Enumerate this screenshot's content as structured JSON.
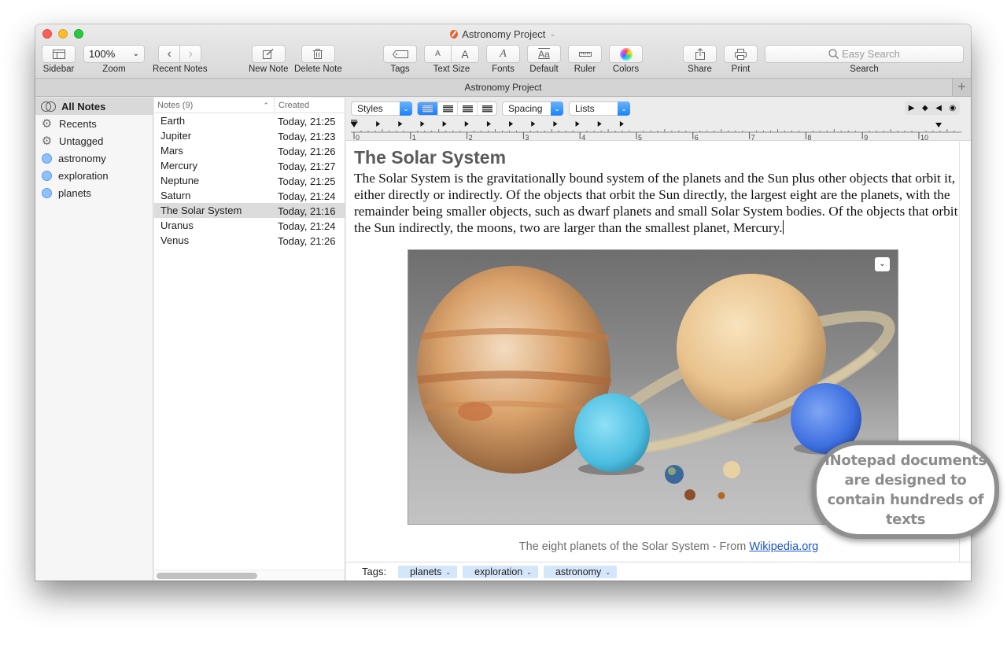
{
  "window": {
    "title": "Astronomy Project",
    "tab_title": "Astronomy Project"
  },
  "toolbar": {
    "sidebar_label": "Sidebar",
    "zoom_value": "100%",
    "zoom_label": "Zoom",
    "recent_notes_label": "Recent Notes",
    "new_note_label": "New Note",
    "delete_note_label": "Delete Note",
    "tags_label": "Tags",
    "text_size_small": "A",
    "text_size_large": "A",
    "text_size_label": "Text Size",
    "fonts_label": "Fonts",
    "default_glyph": "Aa",
    "default_label": "Default",
    "ruler_label": "Ruler",
    "colors_label": "Colors",
    "share_label": "Share",
    "print_label": "Print",
    "search_placeholder": "Easy Search",
    "search_label": "Search"
  },
  "sidebar": {
    "items": [
      {
        "label": "All Notes",
        "icon": "toggle-circles-icon",
        "selected": true
      },
      {
        "label": "Recents",
        "icon": "gear-icon"
      },
      {
        "label": "Untagged",
        "icon": "gear-icon"
      },
      {
        "label": "astronomy",
        "icon": "tag-circle-icon"
      },
      {
        "label": "exploration",
        "icon": "tag-circle-icon"
      },
      {
        "label": "planets",
        "icon": "tag-circle-icon"
      }
    ]
  },
  "notes_list": {
    "header_name": "Notes (9)",
    "header_created": "Created",
    "rows": [
      {
        "name": "Earth",
        "created": "Today, 21:25"
      },
      {
        "name": "Jupiter",
        "created": "Today, 21:23"
      },
      {
        "name": "Mars",
        "created": "Today, 21:26"
      },
      {
        "name": "Mercury",
        "created": "Today, 21:27"
      },
      {
        "name": "Neptune",
        "created": "Today, 21:25"
      },
      {
        "name": "Saturn",
        "created": "Today, 21:24"
      },
      {
        "name": "The Solar System",
        "created": "Today, 21:16",
        "selected": true
      },
      {
        "name": "Uranus",
        "created": "Today, 21:24"
      },
      {
        "name": "Venus",
        "created": "Today, 21:26"
      }
    ]
  },
  "format_bar": {
    "styles": "Styles",
    "spacing": "Spacing",
    "lists": "Lists",
    "alignment_selected": "left",
    "ruler_numbers": [
      "0",
      "1",
      "2",
      "3",
      "4",
      "5",
      "6",
      "7",
      "8",
      "9",
      "10"
    ]
  },
  "document": {
    "title": "The Solar System",
    "body": "The Solar System is the gravitationally bound system of the planets and the Sun plus other objects that orbit it, either directly or indirectly. Of the objects that orbit the Sun directly, the largest eight are the planets, with the remainder being smaller objects, such as dwarf planets and small Solar System bodies. Of the objects that orbit the Sun indirectly, the moons, two are larger than the smallest planet, Mercury.",
    "image_alt": "The eight planets of the Solar System",
    "caption_text": "The eight planets of the Solar System - From ",
    "caption_link": "Wikipedia.org"
  },
  "tags": {
    "label": "Tags:",
    "items": [
      "planets",
      "exploration",
      "astronomy"
    ]
  },
  "callout": {
    "text": "INotepad documents are designed to contain hundreds of texts"
  }
}
